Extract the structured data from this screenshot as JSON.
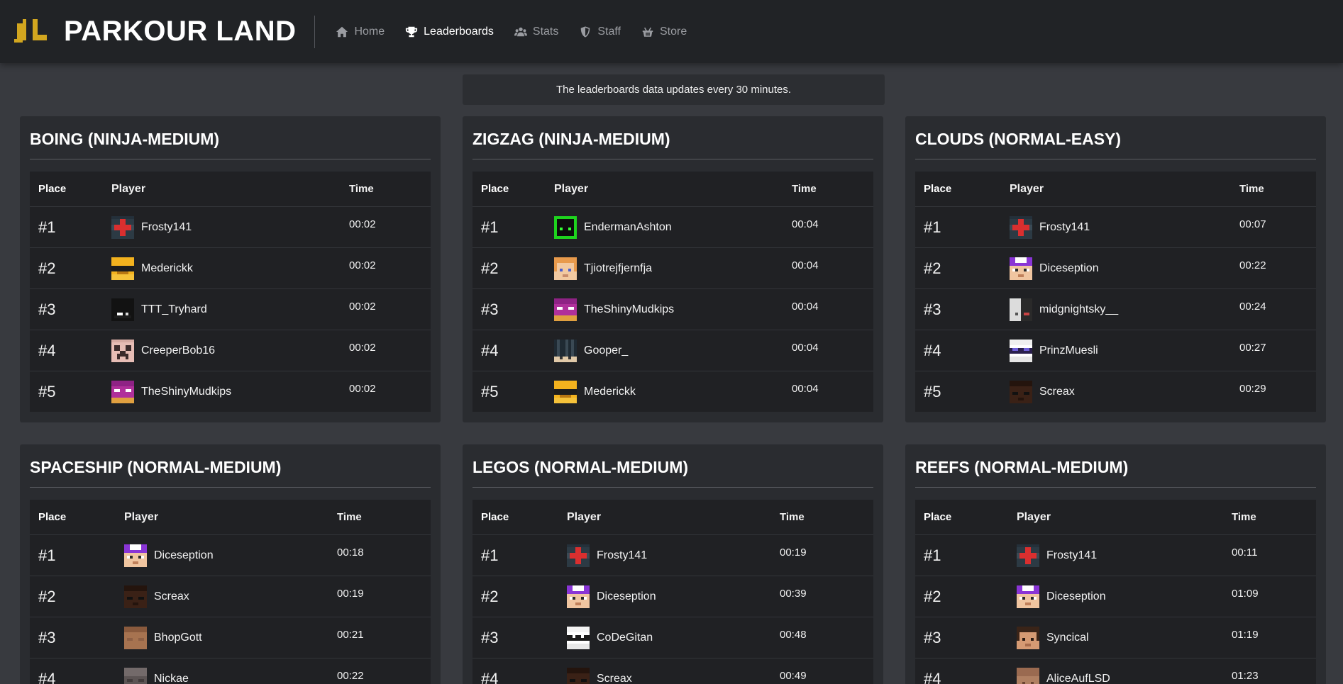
{
  "brand": {
    "title": "PARKOUR LAND",
    "logo_color": "#d2a61f"
  },
  "nav": {
    "items": [
      {
        "label": "Home",
        "icon": "home-icon",
        "active": false
      },
      {
        "label": "Leaderboards",
        "icon": "trophy-icon",
        "active": true
      },
      {
        "label": "Stats",
        "icon": "users-icon",
        "active": false
      },
      {
        "label": "Staff",
        "icon": "shield-icon",
        "active": false
      },
      {
        "label": "Store",
        "icon": "basket-icon",
        "active": false
      }
    ]
  },
  "notice": "The leaderboards data updates every 30 minutes.",
  "columns": {
    "place": "Place",
    "player": "Player",
    "time": "Time"
  },
  "colors": {
    "background": "#383a3f",
    "navbar": "#212326",
    "card": "#2a2c30",
    "table": "#202124"
  },
  "leaderboards": [
    {
      "title": "BOING (NINJA-MEDIUM)",
      "rows": [
        {
          "place": "#1",
          "player": "Frosty141",
          "time": "00:02"
        },
        {
          "place": "#2",
          "player": "Mederickk",
          "time": "00:02"
        },
        {
          "place": "#3",
          "player": "TTT_Tryhard",
          "time": "00:02"
        },
        {
          "place": "#4",
          "player": "CreeperBob16",
          "time": "00:02"
        },
        {
          "place": "#5",
          "player": "TheShinyMudkips",
          "time": "00:02"
        }
      ]
    },
    {
      "title": "ZIGZAG (NINJA-MEDIUM)",
      "rows": [
        {
          "place": "#1",
          "player": "EndermanAshton",
          "time": "00:04"
        },
        {
          "place": "#2",
          "player": "Tjiotrejfjernfja",
          "time": "00:04"
        },
        {
          "place": "#3",
          "player": "TheShinyMudkips",
          "time": "00:04"
        },
        {
          "place": "#4",
          "player": "Gooper_",
          "time": "00:04"
        },
        {
          "place": "#5",
          "player": "Mederickk",
          "time": "00:04"
        }
      ]
    },
    {
      "title": "CLOUDS (NORMAL-EASY)",
      "rows": [
        {
          "place": "#1",
          "player": "Frosty141",
          "time": "00:07"
        },
        {
          "place": "#2",
          "player": "Diceseption",
          "time": "00:22"
        },
        {
          "place": "#3",
          "player": "midgnightsky__",
          "time": "00:24"
        },
        {
          "place": "#4",
          "player": "PrinzMuesli",
          "time": "00:27"
        },
        {
          "place": "#5",
          "player": "Screax",
          "time": "00:29"
        }
      ]
    },
    {
      "title": "SPACESHIP (NORMAL-MEDIUM)",
      "rows": [
        {
          "place": "#1",
          "player": "Diceseption",
          "time": "00:18"
        },
        {
          "place": "#2",
          "player": "Screax",
          "time": "00:19"
        },
        {
          "place": "#3",
          "player": "BhopGott",
          "time": "00:21"
        },
        {
          "place": "#4",
          "player": "Nickae",
          "time": "00:22"
        }
      ]
    },
    {
      "title": "LEGOS (NORMAL-MEDIUM)",
      "rows": [
        {
          "place": "#1",
          "player": "Frosty141",
          "time": "00:19"
        },
        {
          "place": "#2",
          "player": "Diceseption",
          "time": "00:39"
        },
        {
          "place": "#3",
          "player": "CoDeGitan",
          "time": "00:48"
        },
        {
          "place": "#4",
          "player": "Screax",
          "time": "00:49"
        }
      ]
    },
    {
      "title": "REEFS (NORMAL-MEDIUM)",
      "rows": [
        {
          "place": "#1",
          "player": "Frosty141",
          "time": "00:11"
        },
        {
          "place": "#2",
          "player": "Diceseption",
          "time": "01:09"
        },
        {
          "place": "#3",
          "player": "Syncical",
          "time": "01:19"
        },
        {
          "place": "#4",
          "player": "AliceAufLSD",
          "time": "01:23"
        }
      ]
    }
  ]
}
